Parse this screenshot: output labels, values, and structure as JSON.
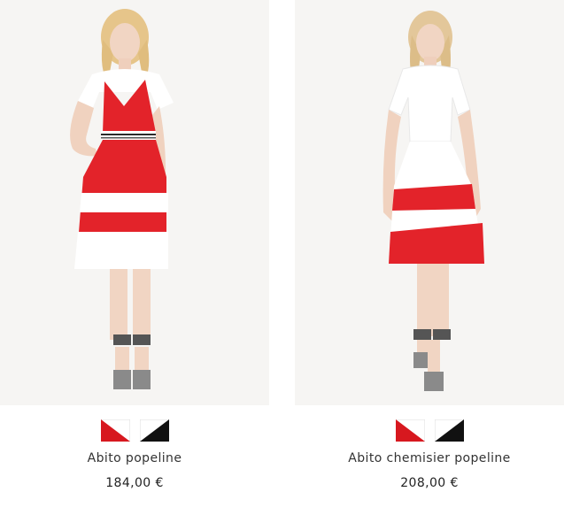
{
  "products": [
    {
      "name": "Abito popeline",
      "price": "184,00 €",
      "swatches": [
        {
          "label": "red-white",
          "colors": [
            "#d7181f",
            "#ffffff"
          ]
        },
        {
          "label": "black-white",
          "colors": [
            "#111111",
            "#ffffff"
          ]
        }
      ]
    },
    {
      "name": "Abito chemisier popeline",
      "price": "208,00 €",
      "swatches": [
        {
          "label": "red-white",
          "colors": [
            "#d7181f",
            "#ffffff"
          ]
        },
        {
          "label": "black-white",
          "colors": [
            "#111111",
            "#ffffff"
          ]
        }
      ]
    }
  ],
  "colors": {
    "photo_background": "#f6f5f3",
    "dress_red": "#e3232a",
    "skin": "#f1d5c3",
    "hair": "#e6c58a"
  }
}
